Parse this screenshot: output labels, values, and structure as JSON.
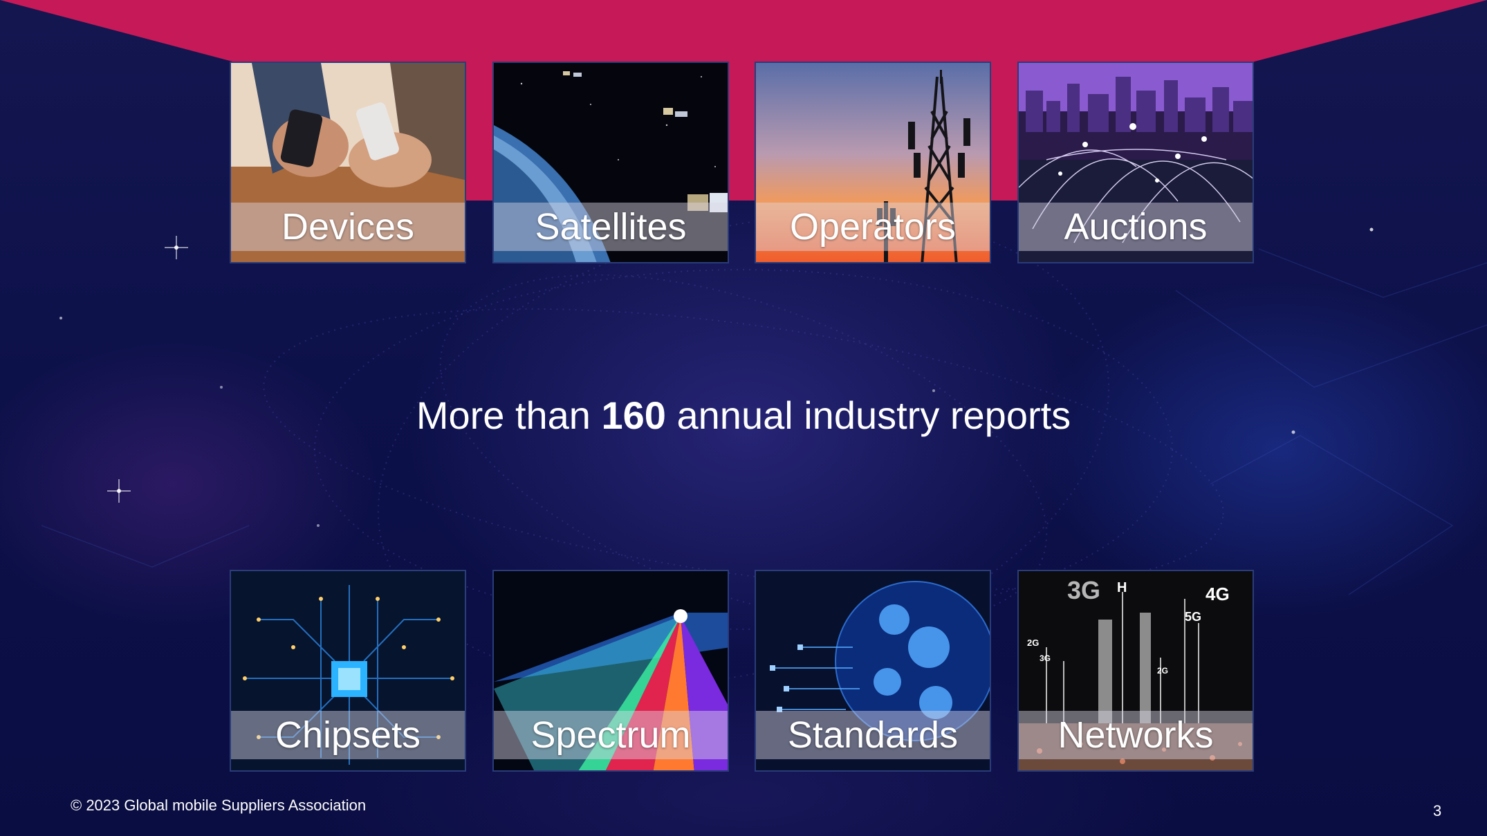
{
  "slide": {
    "headline": {
      "prefix": "More than ",
      "number": "160",
      "suffix": " annual industry reports"
    },
    "footer": "© 2023 Global mobile Suppliers Association",
    "page_number": "3"
  },
  "tiles_top": [
    {
      "label": "Devices",
      "image": "people-using-smartphones"
    },
    {
      "label": "Satellites",
      "image": "satellites-over-earth"
    },
    {
      "label": "Operators",
      "image": "cell-tower-sunset"
    },
    {
      "label": "Auctions",
      "image": "connected-city-skyline"
    }
  ],
  "tiles_bottom": [
    {
      "label": "Chipsets",
      "image": "circuit-board-chip"
    },
    {
      "label": "Spectrum",
      "image": "light-spectrum-prism"
    },
    {
      "label": "Standards",
      "image": "digital-globe"
    },
    {
      "label": "Networks",
      "image": "network-generations-3g-4g-5g"
    }
  ],
  "network_tile_text": [
    "3G",
    "H",
    "4G",
    "5G",
    "2G",
    "3G",
    "2G"
  ],
  "colors": {
    "brand_band": "#c51a57",
    "background": "#0b0f45",
    "text": "#ffffff"
  }
}
